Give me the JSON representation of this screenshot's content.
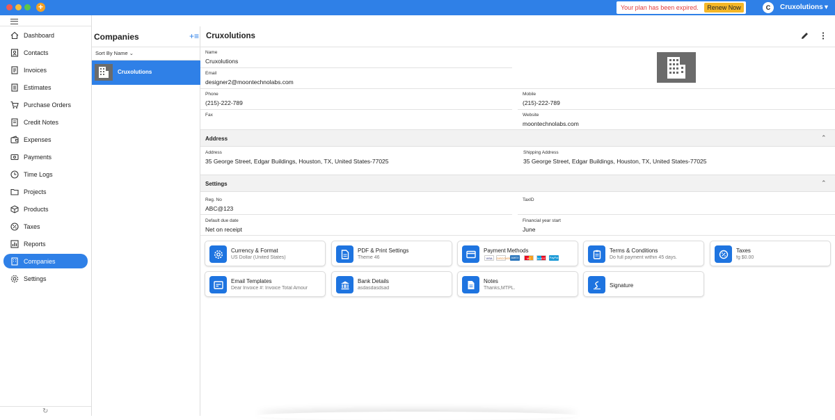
{
  "titlebar": {
    "expired_message": "Your plan has been expired.",
    "renew_label": "Renew Now",
    "avatar_letter": "C",
    "account_name": "Cruxolutions",
    "accent": "#2f80e7"
  },
  "sidebar": {
    "items": [
      {
        "label": "Dashboard",
        "icon": "home-icon"
      },
      {
        "label": "Contacts",
        "icon": "contacts-icon"
      },
      {
        "label": "Invoices",
        "icon": "invoice-icon"
      },
      {
        "label": "Estimates",
        "icon": "estimate-icon"
      },
      {
        "label": "Purchase Orders",
        "icon": "cart-icon"
      },
      {
        "label": "Credit Notes",
        "icon": "credit-note-icon"
      },
      {
        "label": "Expenses",
        "icon": "wallet-icon"
      },
      {
        "label": "Payments",
        "icon": "payment-icon"
      },
      {
        "label": "Time Logs",
        "icon": "clock-icon"
      },
      {
        "label": "Projects",
        "icon": "folder-icon"
      },
      {
        "label": "Products",
        "icon": "box-icon"
      },
      {
        "label": "Taxes",
        "icon": "percent-icon"
      },
      {
        "label": "Reports",
        "icon": "bar-chart-icon"
      },
      {
        "label": "Companies",
        "icon": "building-icon"
      },
      {
        "label": "Settings",
        "icon": "gear-icon"
      }
    ],
    "active": "Companies"
  },
  "companies_panel": {
    "title": "Companies",
    "sort_label": "Sort By Name",
    "items": [
      {
        "name": "Cruxolutions"
      }
    ]
  },
  "detail": {
    "title": "Cruxolutions",
    "name_label": "Name",
    "name": "Cruxolutions",
    "email_label": "Email",
    "email": "designer2@moontechnolabs.com",
    "phone_label": "Phone",
    "phone": "(215)-222-789",
    "mobile_label": "Mobile",
    "mobile": "(215)-222-789",
    "fax_label": "Fax",
    "fax": "",
    "website_label": "Website",
    "website": "moontechnolabs.com",
    "address_section": "Address",
    "address_label": "Address",
    "address": "35 George Street, Edgar Buildings, Houston, TX, United States-77025",
    "shipping_label": "Shipping Address",
    "shipping": "35 George Street, Edgar Buildings, Houston, TX, United States-77025",
    "settings_section": "Settings",
    "regno_label": "Reg. No",
    "regno": "ABC@123",
    "taxid_label": "TaxID",
    "taxid": "",
    "due_label": "Default due date",
    "due": "Net on receipt",
    "fy_label": "Financial year start",
    "fy": "June"
  },
  "cards": [
    {
      "title": "Currency & Format",
      "sub": "US Dollar (United States)",
      "icon": "gear-icon"
    },
    {
      "title": "PDF & Print Settings",
      "sub": "Theme 46",
      "icon": "document-icon"
    },
    {
      "title": "Payment Methods",
      "sub": "",
      "icon": "credit-card-icon"
    },
    {
      "title": "Terms & Conditions",
      "sub": "Do full payment within 45 days.",
      "icon": "clipboard-icon"
    },
    {
      "title": "Taxes",
      "sub": "fg $0.00",
      "icon": "percent-icon"
    },
    {
      "title": "Email Templates",
      "sub": "Dear   Invoice #:  Invoice Total Amour",
      "icon": "email-template-icon"
    },
    {
      "title": "Bank Details",
      "sub": "asdasdasdsad",
      "icon": "bank-icon"
    },
    {
      "title": "Notes",
      "sub": "Thanks,MTPL.",
      "icon": "note-icon"
    },
    {
      "title": "Signature",
      "sub": "",
      "icon": "signature-icon"
    }
  ],
  "payment_methods": [
    {
      "label": "VISA",
      "color": "#ffffff"
    },
    {
      "label": "DISCOVER",
      "color": "#ffffff"
    },
    {
      "label": "AMEX",
      "color": "#2e77bc"
    },
    {
      "label": "MC",
      "color": "#ffffff"
    },
    {
      "label": "MAESTRO",
      "color": "#ffffff"
    },
    {
      "label": "PayPal",
      "color": "#1e9bd7"
    }
  ]
}
